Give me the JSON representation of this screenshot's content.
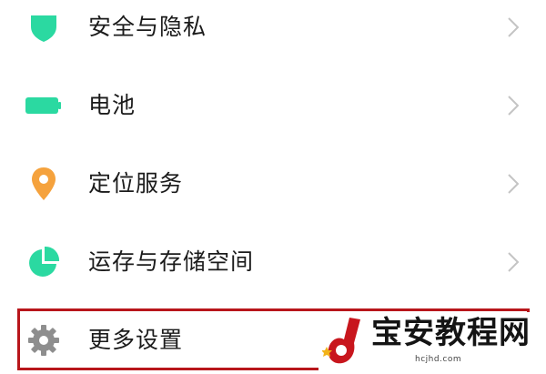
{
  "settings": {
    "items": [
      {
        "label": "安全与隐私",
        "icon": "shield-icon",
        "icon_color": "#2bd9a1",
        "has_chevron": true
      },
      {
        "label": "电池",
        "icon": "battery-icon",
        "icon_color": "#2bd9a1",
        "has_chevron": true
      },
      {
        "label": "定位服务",
        "icon": "location-pin-icon",
        "icon_color": "#f5a23d",
        "has_chevron": true
      },
      {
        "label": "运存与存储空间",
        "icon": "pie-chart-icon",
        "icon_color": "#2bd9a1",
        "has_chevron": true
      },
      {
        "label": "更多设置",
        "icon": "gear-icon",
        "icon_color": "#8e8e8e",
        "has_chevron": false
      }
    ]
  },
  "highlight": {
    "color": "#b8161b",
    "target": "更多设置"
  },
  "watermark": {
    "text": "宝安教程网",
    "url": "hcjhd.com",
    "logo_color": "#c8161d"
  }
}
